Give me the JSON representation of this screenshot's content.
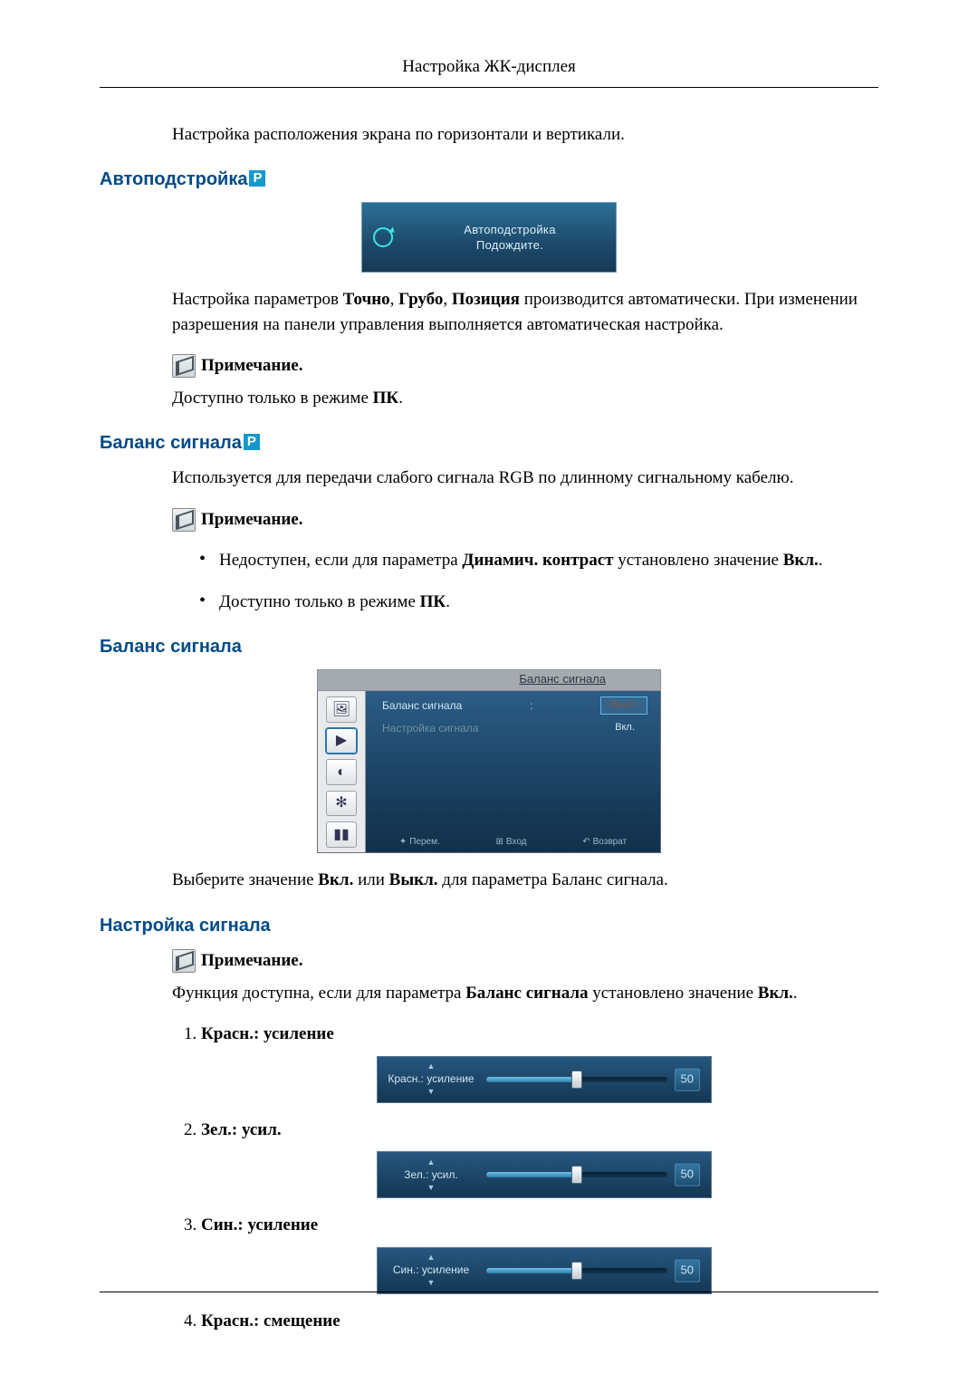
{
  "page": {
    "header": "Настройка ЖК-дисплея"
  },
  "intro": {
    "text": "Настройка расположения экрана по горизонтали и вертикали."
  },
  "auto": {
    "heading": "Автоподстройка",
    "panel_line1": "Автоподстройка",
    "panel_line2": "Подождите.",
    "para_pre": "Настройка параметров ",
    "b1": "Точно",
    "b2": "Грубо",
    "b3": "Позиция",
    "para_mid": " производится автоматически. При изменении разрешения на панели управления выполняется автоматическая настройка.",
    "note": "Примечание.",
    "note_para_pre": "Доступно только в режиме ",
    "note_para_bold": "ПК",
    "note_para_post": "."
  },
  "balance1": {
    "heading": "Баланс сигнала",
    "para": "Используется для передачи слабого сигнала RGB по длинному сигнальному кабелю.",
    "note": "Примечание.",
    "bullet1_pre": "Недоступен, если для параметра ",
    "bullet1_b1": "Динамич. контраст",
    "bullet1_mid": " установлено значение ",
    "bullet1_b2": "Вкл.",
    "bullet1_post": ".",
    "bullet2_pre": "Доступно только в режиме ",
    "bullet2_b": "ПК",
    "bullet2_post": "."
  },
  "balance2": {
    "heading": "Баланс сигнала",
    "osd": {
      "title": "Баланс сигнала",
      "row1_label": "Баланс сигнала",
      "row1_val": "Выкл.",
      "row2_label": "Настройка сигнала",
      "row2_val": "Вкл.",
      "footer_move": "Перем.",
      "footer_enter": "Вход",
      "footer_return": "Возврат"
    },
    "after_pre": "Выберите значение ",
    "after_b1": "Вкл.",
    "after_mid1": " или ",
    "after_b2": "Выкл.",
    "after_post": " для параметра Баланс сигнала."
  },
  "signal": {
    "heading": "Настройка сигнала",
    "note": "Примечание.",
    "para_pre": "Функция доступна, если для параметра ",
    "para_b1": "Баланс сигнала",
    "para_mid": " установлено значение ",
    "para_b2": "Вкл.",
    "para_post": ".",
    "items": [
      {
        "label": "Красн.: усиление",
        "value": "50"
      },
      {
        "label": "Зел.: усил.",
        "value": "50"
      },
      {
        "label": "Син.: усиление",
        "value": "50"
      },
      {
        "label": "Красн.: смещение"
      }
    ]
  }
}
